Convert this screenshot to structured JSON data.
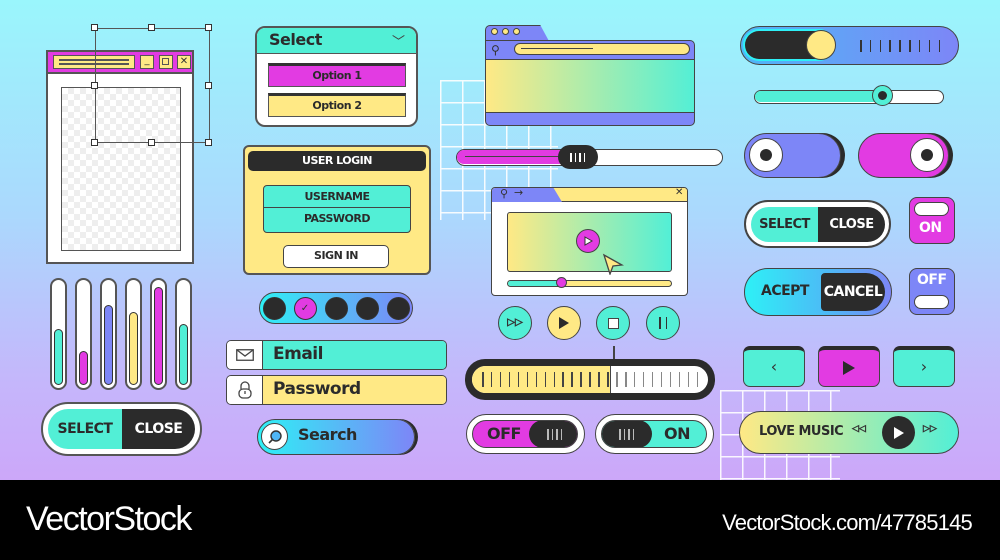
{
  "colors": {
    "cyan": "#52efd6",
    "magenta": "#e23be2",
    "yellow": "#ffe985",
    "periwinkle": "#7d86f7",
    "dark": "#2b2b2b",
    "white": "#ffffff"
  },
  "window_editor": {
    "titlebar_buttons": [
      "minimize",
      "maximize",
      "close"
    ]
  },
  "select_dropdown": {
    "label": "Select",
    "options": [
      "Option 1",
      "Option 2"
    ],
    "selected": "Option 1"
  },
  "user_login": {
    "title": "USER LOGIN",
    "username_label": "USERNAME",
    "password_label": "PASSWORD",
    "signin_label": "SIGN IN"
  },
  "vertical_bars": [
    {
      "color": "#52efd6",
      "level": 0.55
    },
    {
      "color": "#e23be2",
      "level": 0.33
    },
    {
      "color": "#7d86f7",
      "level": 0.78
    },
    {
      "color": "#ffe985",
      "level": 0.72
    },
    {
      "color": "#e23be2",
      "level": 0.96
    },
    {
      "color": "#52efd6",
      "level": 0.6
    }
  ],
  "select_close_left": {
    "select": "SELECT",
    "close": "CLOSE"
  },
  "pagination_dots": {
    "count": 5,
    "active_index": 1
  },
  "email_field": {
    "label": "Email"
  },
  "password_field": {
    "label": "Password"
  },
  "search": {
    "label": "Search"
  },
  "magenta_slider": {
    "value": 0.42
  },
  "video_player": {
    "progress": 0.33
  },
  "media_controls": [
    "fast-forward",
    "play",
    "stop",
    "pause"
  ],
  "ruler_slider": {
    "value": 0.59
  },
  "toggle_off": {
    "label": "OFF"
  },
  "toggle_on": {
    "label": "ON"
  },
  "knob_slider": {
    "value": 0.38
  },
  "teal_slider": {
    "value": 0.68
  },
  "switch_periwinkle": {
    "state": "off"
  },
  "switch_magenta": {
    "state": "on"
  },
  "select_close_right": {
    "select": "SELECT",
    "close": "CLOSE"
  },
  "on_switch": {
    "label": "ON"
  },
  "accept_cancel": {
    "accept": "ACEPT",
    "cancel": "CANCEL"
  },
  "off_switch": {
    "label": "OFF"
  },
  "nav_buttons": [
    "previous",
    "play",
    "next"
  ],
  "music_player": {
    "label": "LOVE MUSIC"
  },
  "footer": {
    "brand": "VectorStock",
    "url": "VectorStock.com/47785145"
  }
}
